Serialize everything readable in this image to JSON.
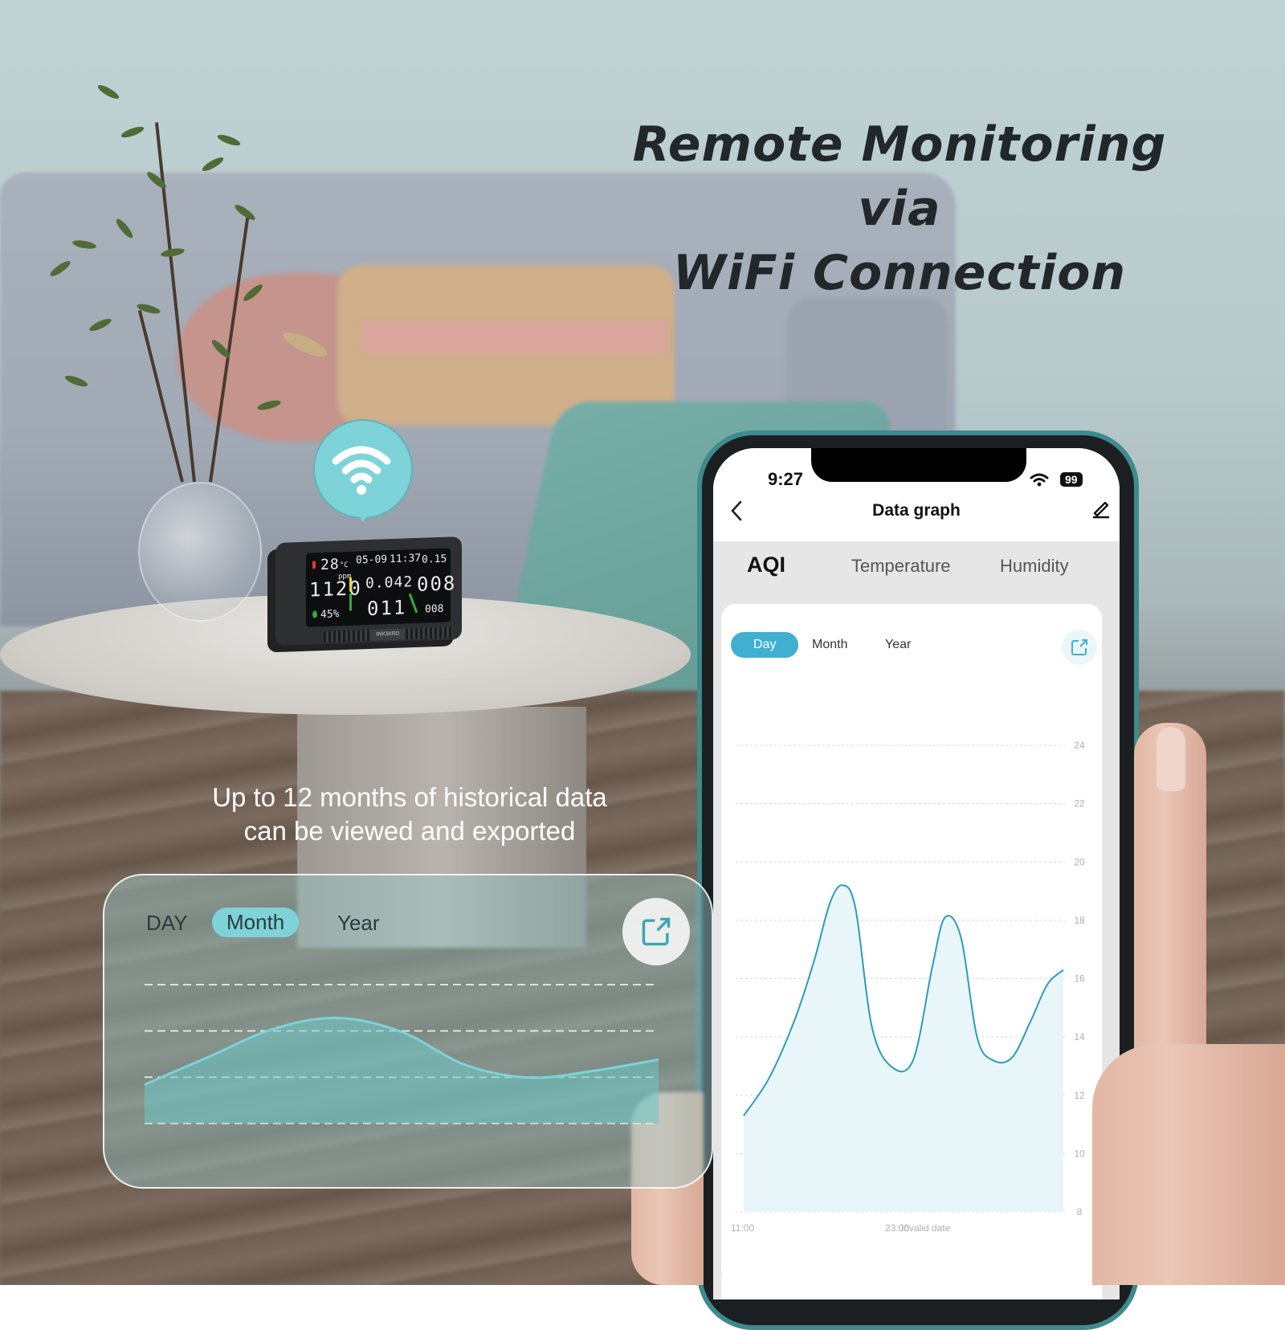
{
  "headline": {
    "line1": "Remote Monitoring via",
    "line2": "WiFi Connection"
  },
  "caption": {
    "line1": "Up to 12 months of historical data",
    "line2": "can be viewed and exported"
  },
  "device": {
    "brand": "INKBIRD",
    "date": "05-09",
    "time": "11:37",
    "temperature": "28",
    "temperature_unit": "°C",
    "co2": "1120",
    "co2_unit": "ppm",
    "humidity": "45%",
    "hcho": "0.15",
    "tvoc": "0.042",
    "aqi": "011",
    "pm25": "008",
    "pm10": "008"
  },
  "glass_card": {
    "tabs": [
      {
        "label": "DAY",
        "active": false
      },
      {
        "label": "Month",
        "active": true
      },
      {
        "label": "Year",
        "active": false
      }
    ],
    "export_icon": "export-icon",
    "accent_color": "#7dd3d8",
    "series": [
      0.28,
      0.48,
      0.68,
      0.76,
      0.66,
      0.42,
      0.33,
      0.38,
      0.46
    ]
  },
  "phone": {
    "status_bar": {
      "time": "9:27",
      "battery": "99",
      "wifi_icon": "wifi-icon"
    },
    "nav": {
      "title": "Data graph",
      "back_icon": "chevron-left-icon",
      "edit_icon": "pencil-icon"
    },
    "metric_tabs": [
      {
        "label": "AQI",
        "active": true
      },
      {
        "label": "Temperature",
        "active": false
      },
      {
        "label": "Humidity",
        "active": false
      }
    ],
    "range_tabs": [
      {
        "label": "Day",
        "active": true
      },
      {
        "label": "Month",
        "active": false
      },
      {
        "label": "Year",
        "active": false
      }
    ],
    "accent_color": "#41afd0"
  },
  "chart_data": {
    "type": "area",
    "title": "AQI",
    "xlabel": "",
    "ylabel": "",
    "x_tick_labels": [
      "11:00",
      "23:00",
      "Invalid date"
    ],
    "y_ticks": [
      8,
      10,
      12,
      14,
      16,
      18,
      20,
      22,
      24
    ],
    "ylim": [
      8,
      24
    ],
    "grid": true,
    "y_axis_side": "right",
    "series": [
      {
        "name": "AQI",
        "x": [
          0,
          0.08,
          0.16,
          0.22,
          0.27,
          0.31,
          0.35,
          0.4,
          0.46,
          0.53,
          0.59,
          0.63,
          0.68,
          0.73,
          0.78,
          0.84,
          0.9,
          0.95,
          1.0
        ],
        "values": [
          11.3,
          12.6,
          14.6,
          16.6,
          18.6,
          19.2,
          18.4,
          14.4,
          13.0,
          13.2,
          16.4,
          18.1,
          17.4,
          14.0,
          13.2,
          13.3,
          14.6,
          15.8,
          16.3
        ]
      }
    ]
  }
}
